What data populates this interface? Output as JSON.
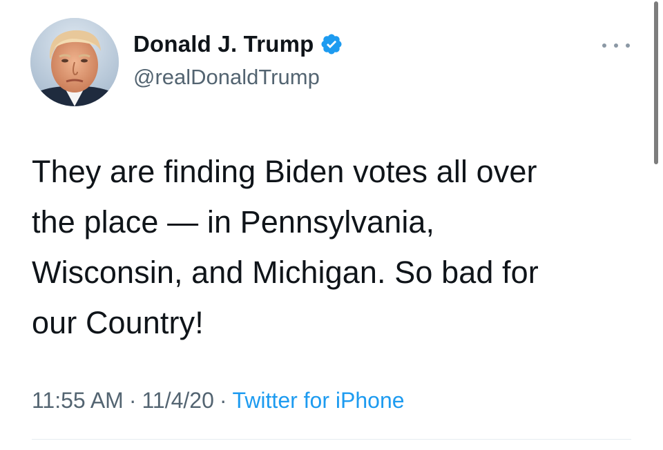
{
  "tweet": {
    "author": {
      "display_name": "Donald J. Trump",
      "handle": "@realDonaldTrump",
      "verified": true,
      "avatar_icon": "profile-photo"
    },
    "text": "They are finding Biden votes all over\nthe place — in Pennsylvania,\nWisconsin, and Michigan. So bad for\nour Country!",
    "time": "11:55 AM",
    "date": "11/4/20",
    "separator": "·",
    "source": "Twitter for iPhone"
  },
  "colors": {
    "verified_badge": "#1d9bf0",
    "link": "#1d9bf0",
    "secondary_text": "#536471",
    "primary_text": "#0f1419"
  },
  "icons": {
    "more": "more-options-icon",
    "verified": "verified-badge-icon"
  }
}
